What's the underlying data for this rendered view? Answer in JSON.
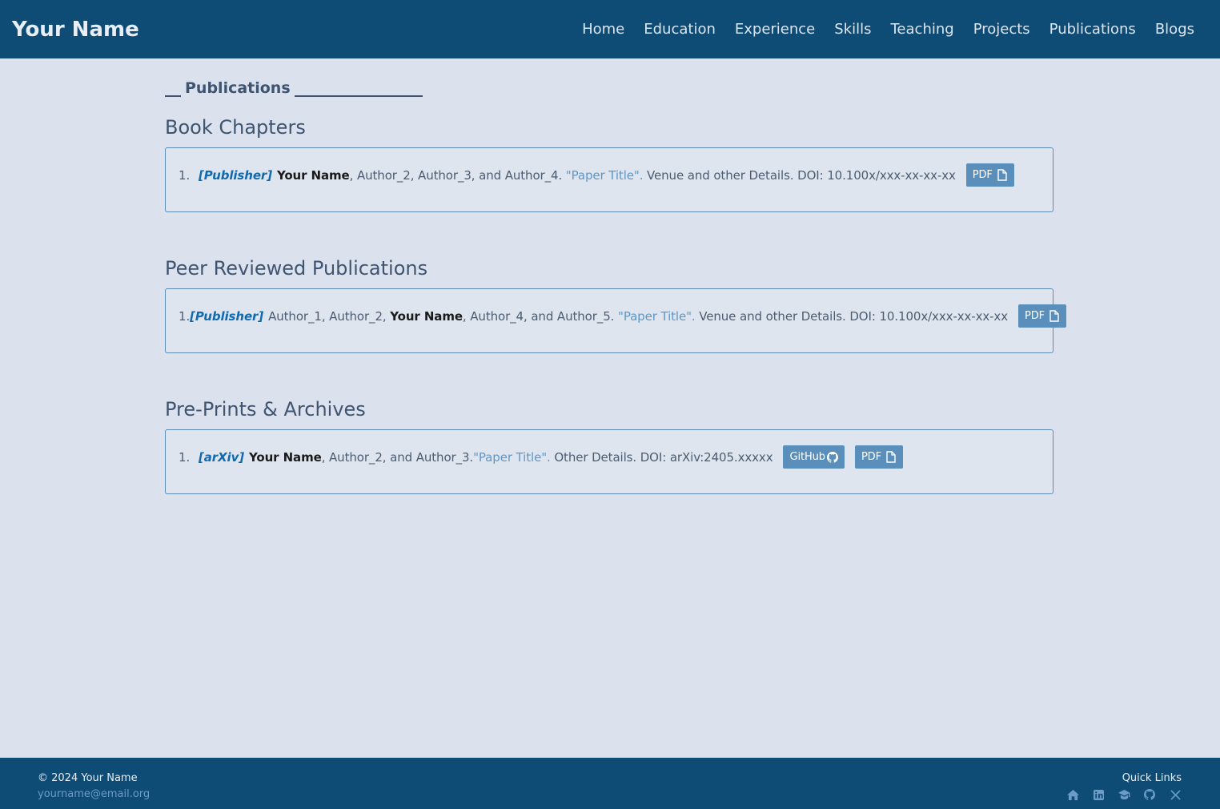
{
  "brand": "Your Name",
  "nav": [
    "Home",
    "Education",
    "Experience",
    "Skills",
    "Teaching",
    "Projects",
    "Publications",
    "Blogs"
  ],
  "page_title": "Publications",
  "sections": [
    {
      "heading": "Book Chapters",
      "num": "1.",
      "publisher": "[Publisher]",
      "pre": "",
      "me": "Your Name",
      "post": ", Author_2, Author_3, and Author_4. ",
      "title": "\"Paper Title\".",
      "details": " Venue and other Details. DOI: 10.100x/xxx-xx-xx-xx",
      "pdf": "PDF"
    },
    {
      "heading": "Peer Reviewed Publications",
      "num": "1.",
      "publisher": "[Publisher]",
      "pre": "Author_1, Author_2, ",
      "me": "Your Name",
      "post": ", Author_4, and Author_5. ",
      "title": "\"Paper Title\".",
      "details": " Venue and other Details. DOI: 10.100x/xxx-xx-xx-xx",
      "pdf": "PDF"
    },
    {
      "heading": "Pre-Prints & Archives",
      "num": "1.",
      "publisher": "[arXiv]",
      "pre": "",
      "me": "Your Name",
      "post": ", Author_2, and Author_3.",
      "title": "\"Paper Title\".",
      "details": " Other Details. DOI: arXiv:2405.xxxxx",
      "github": "GitHub",
      "pdf": "PDF"
    }
  ],
  "footer": {
    "copyright": "© 2024 Your Name",
    "email": "yourname@email.org",
    "quick_links": "Quick Links",
    "icons": [
      "home-icon",
      "linkedin-icon",
      "graduation-cap-icon",
      "github-icon",
      "x-icon"
    ]
  },
  "colors": {
    "nav_bg": "#0f4c75",
    "page_bg": "#dbe2ee",
    "accent": "#0f6ab0",
    "button": "#5b8fbb"
  }
}
